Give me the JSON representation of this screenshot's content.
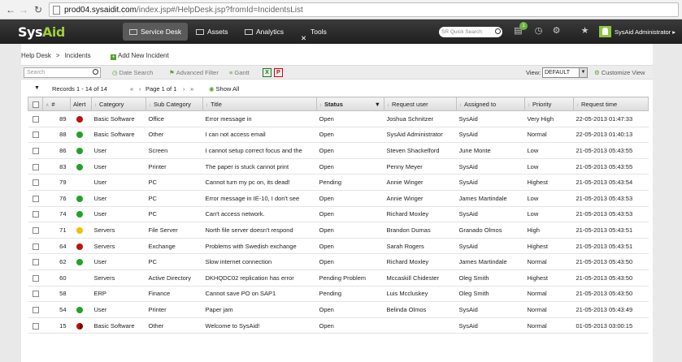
{
  "browser": {
    "url_host": "prod04.sysaidit.com",
    "url_path": "/index.jsp#/HelpDesk.jsp?fromId=IncidentsList"
  },
  "header": {
    "logo_sys": "Sys",
    "logo_aid": "Aid",
    "nav": [
      {
        "label": "Service Desk",
        "icon": "service-desk-icon"
      },
      {
        "label": "Assets",
        "icon": "monitor-icon"
      },
      {
        "label": "Analytics",
        "icon": "chart-icon"
      },
      {
        "label": "Tools",
        "icon": "tools-icon"
      }
    ],
    "quick_search_placeholder": "SR Quick Search",
    "notification_count": "1",
    "user_name": "SysAid Administrator"
  },
  "breadcrumb": {
    "root": "Help Desk",
    "sep": ">",
    "current": "Incidents"
  },
  "add_new_label": "Add New Incident",
  "toolbar": {
    "search_placeholder": "Search",
    "date_search": "Date Search",
    "advanced_filter": "Advanced Filter",
    "gantt": "Gantt",
    "view_label": "View:",
    "view_value": "DEFAULT",
    "customize_view": "Customize View"
  },
  "pager": {
    "records": "Records 1 - 14 of 14",
    "first": "«",
    "prev": "‹",
    "page_text": "Page 1 of 1",
    "next": "›",
    "last": "»",
    "show_all": "Show All"
  },
  "columns": {
    "num": "#",
    "alert": "Alert",
    "category": "Category",
    "sub_category": "Sub Category",
    "title": "Title",
    "status": "Status",
    "request_user": "Request user",
    "assigned_to": "Assigned to",
    "priority": "Priority",
    "request_time": "Request time"
  },
  "alert_colors": {
    "red": "#c01010",
    "green": "#22a22a",
    "yellow": "#f0c000"
  },
  "rows": [
    {
      "id": "89",
      "alert": "red",
      "category": "Basic Software",
      "sub": "Office",
      "title": "Error message in",
      "status": "Open",
      "user": "Joshua Schnitzer",
      "assigned": "SysAid",
      "priority": "Very High",
      "time": "22-05-2013 01:47:33"
    },
    {
      "id": "88",
      "alert": "green",
      "category": "Basic Software",
      "sub": "Other",
      "title": "I can not access email",
      "status": "Open",
      "user": "SysAid Administrator",
      "assigned": "SysAid",
      "priority": "Normal",
      "time": "22-05-2013 01:40:13"
    },
    {
      "id": "86",
      "alert": "green",
      "category": "User",
      "sub": "Screen",
      "title": "I cannot setup correct focus and the",
      "status": "Open",
      "user": "Steven Shackelford",
      "assigned": "June Monte",
      "priority": "Low",
      "time": "21-05-2013 05:43:55"
    },
    {
      "id": "83",
      "alert": "green",
      "category": "User",
      "sub": "Printer",
      "title": "The paper is stuck cannot print",
      "status": "Open",
      "user": "Penny Meyer",
      "assigned": "SysAid",
      "priority": "Low",
      "time": "21-05-2013 05:43:55"
    },
    {
      "id": "79",
      "alert": "",
      "category": "User",
      "sub": "PC",
      "title": "Cannot turn my pc on, its dead!",
      "status": "Pending",
      "user": "Annie Winger",
      "assigned": "SysAid",
      "priority": "Highest",
      "time": "21-05-2013 05:43:54"
    },
    {
      "id": "76",
      "alert": "green",
      "category": "User",
      "sub": "PC",
      "title": "Error message in IE-10, I don't see",
      "status": "Open",
      "user": "Annie Winger",
      "assigned": "James Martindale",
      "priority": "Low",
      "time": "21-05-2013 05:43:53"
    },
    {
      "id": "74",
      "alert": "green",
      "category": "User",
      "sub": "PC",
      "title": "Can't access network.",
      "status": "Open",
      "user": "Richard Moxley",
      "assigned": "SysAid",
      "priority": "Low",
      "time": "21-05-2013 05:43:53"
    },
    {
      "id": "71",
      "alert": "yellow",
      "category": "Servers",
      "sub": "File Server",
      "title": "North file server doesn't respond",
      "status": "Open",
      "user": "Brandon Dumas",
      "assigned": "Granado Olmos",
      "priority": "High",
      "time": "21-05-2013 05:43:51"
    },
    {
      "id": "64",
      "alert": "red",
      "category": "Servers",
      "sub": "Exchange",
      "title": "Problems with Swedish exchange",
      "status": "Open",
      "user": "Sarah Rogers",
      "assigned": "SysAid",
      "priority": "Highest",
      "time": "21-05-2013 05:43:51"
    },
    {
      "id": "62",
      "alert": "green",
      "category": "User",
      "sub": "PC",
      "title": "Slow internet connection",
      "status": "Open",
      "user": "Richard Moxley",
      "assigned": "James Martindale",
      "priority": "Normal",
      "time": "21-05-2013 05:43:50"
    },
    {
      "id": "60",
      "alert": "",
      "category": "Servers",
      "sub": "Active Directory",
      "title": "DKHQDC02 replication has error",
      "status": "Pending Problem",
      "user": "Mccaskill Chidester",
      "assigned": "Oleg Smith",
      "priority": "Highest",
      "time": "21-05-2013 05:43:50"
    },
    {
      "id": "58",
      "alert": "",
      "category": "ERP",
      "sub": "Finance",
      "title": "Cannot save PO on SAP1",
      "status": "Pending",
      "user": "Luis Mccluskey",
      "assigned": "Oleg Smith",
      "priority": "Normal",
      "time": "21-05-2013 05:43:50"
    },
    {
      "id": "54",
      "alert": "green",
      "category": "User",
      "sub": "Printer",
      "title": "Paper jam",
      "status": "Open",
      "user": "Belinda Olmos",
      "assigned": "SysAid",
      "priority": "Normal",
      "time": "21-05-2013 05:43:49"
    },
    {
      "id": "15",
      "alert": "half",
      "category": "Basic Software",
      "sub": "Other",
      "title": "Welcome to SysAid!",
      "status": "Open",
      "user": "",
      "assigned": "SysAid",
      "priority": "Normal",
      "time": "01-05-2013 03:00:15"
    }
  ]
}
